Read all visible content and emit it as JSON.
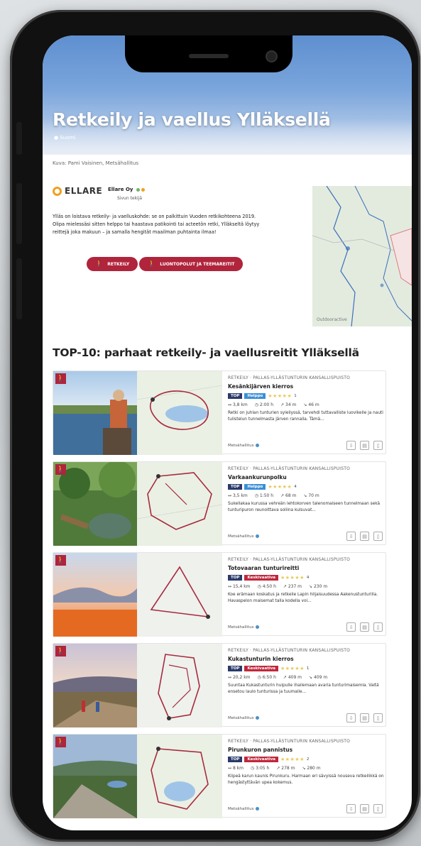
{
  "hero": {
    "title": "Retkeily ja vaellus Ylläksellä",
    "subtitle": "Suomi",
    "credit": "Kuva: Pami Vaisinen, Metsähallitus"
  },
  "org": {
    "logo_text": "ELLARE",
    "name": "Ellare Oy",
    "role": "Sivun tekijä"
  },
  "intro": "Ylläs on loistava retkeily- ja vaelluskohde: se on palkittuin Vuoden retkikohteena 2019. Olipa mielessäsi sitten helppo tai haastava patikointi tai acteetön retki, Ylläkseltä löytyy reittejä joka makuun – ja samalla hengität maailman puhtainta ilmaa!",
  "pills": [
    {
      "label": "RETKEILY",
      "icon": "hiker-icon"
    },
    {
      "label": "LUONTOPOLUT JA TEEMAREITIT",
      "icon": "nature-trail-icon"
    }
  ],
  "map": {
    "label": "Outdooractive"
  },
  "section_title": "TOP-10: parhaat retkeily- ja vaellusreitit Ylläksellä",
  "routes": [
    {
      "region": "RETKEILY · PALLAS-YLLÄSTUNTURIN KANSALLISPUISTO",
      "name": "Kesänkijärven kierros",
      "top": "TOP",
      "level": "Helppo",
      "level_color": "#3b8fd6",
      "rating": "1",
      "distance": "3,8 km",
      "duration": "2:00 h",
      "ascent": "34 m",
      "descent": "46 m",
      "desc": "Retki on juhlan tunturien syleilyssä, tarvehdi tuttavalliste luovikelle ja nauti tulistelun tunnelmasta järven rannalla. Tämä...",
      "source": "Metsähallitus"
    },
    {
      "region": "RETKEILY · PALLAS-YLLÄSTUNTURIN KANSALLISPUISTO",
      "name": "Varkaankurunpolku",
      "top": "TOP",
      "level": "Helppo",
      "level_color": "#3b8fd6",
      "rating": "4",
      "distance": "3,5 km",
      "duration": "1:50 h",
      "ascent": "68 m",
      "descent": "70 m",
      "desc": "Sukellakaa kurussa vehreän lehtokorven talenomaiseen tunnelmaan sekä tunturipuron reunoittava soliina kulsuvat...",
      "source": "Metsähallitus"
    },
    {
      "region": "RETKEILY · PALLAS-YLLÄSTUNTURIN KANSALLISPUISTO",
      "name": "Totovaaran tunturireitti",
      "top": "TOP",
      "level": "Keskivaativa",
      "level_color": "#c0283c",
      "rating": "4",
      "distance": "15,4 km",
      "duration": "4:50 h",
      "ascent": "237 m",
      "descent": "230 m",
      "desc": "Koe erämaan koskatus ja retkeile Lapin hiljaisuudessa Aakenustunturilla. Havaspelon maisemat talla kodella voi...",
      "source": "Metsähallitus"
    },
    {
      "region": "RETKEILY · PALLAS-YLLÄSTUNTURIN KANSALLISPUISTO",
      "name": "Kukastunturin kierros",
      "top": "TOP",
      "level": "Keskivaativa",
      "level_color": "#c0283c",
      "rating": "1",
      "distance": "20,2 km",
      "duration": "6:50 h",
      "ascent": "409 m",
      "descent": "409 m",
      "desc": "Suuntaa Kukastunturin huipulle ihailemaan avaria tunturimaisemia. Valtä ensetou laulo tunturissa ja tuumaile...",
      "source": "Metsähallitus"
    },
    {
      "region": "RETKEILY · PALLAS-YLLÄSTUNTURIN KANSALLISPUISTO",
      "name": "Pirunkuron pannistus",
      "top": "TOP",
      "level": "Keskivaativa",
      "level_color": "#c0283c",
      "rating": "2",
      "distance": "8 km",
      "duration": "3:05 h",
      "ascent": "278 m",
      "descent": "280 m",
      "desc": "Kiipeä karun kaunis Pirunkuru. Harmaan eri sävyissä nouseva retkeilikkä on hengästyttävän upea kokemus.",
      "source": "Metsähallitus"
    }
  ]
}
